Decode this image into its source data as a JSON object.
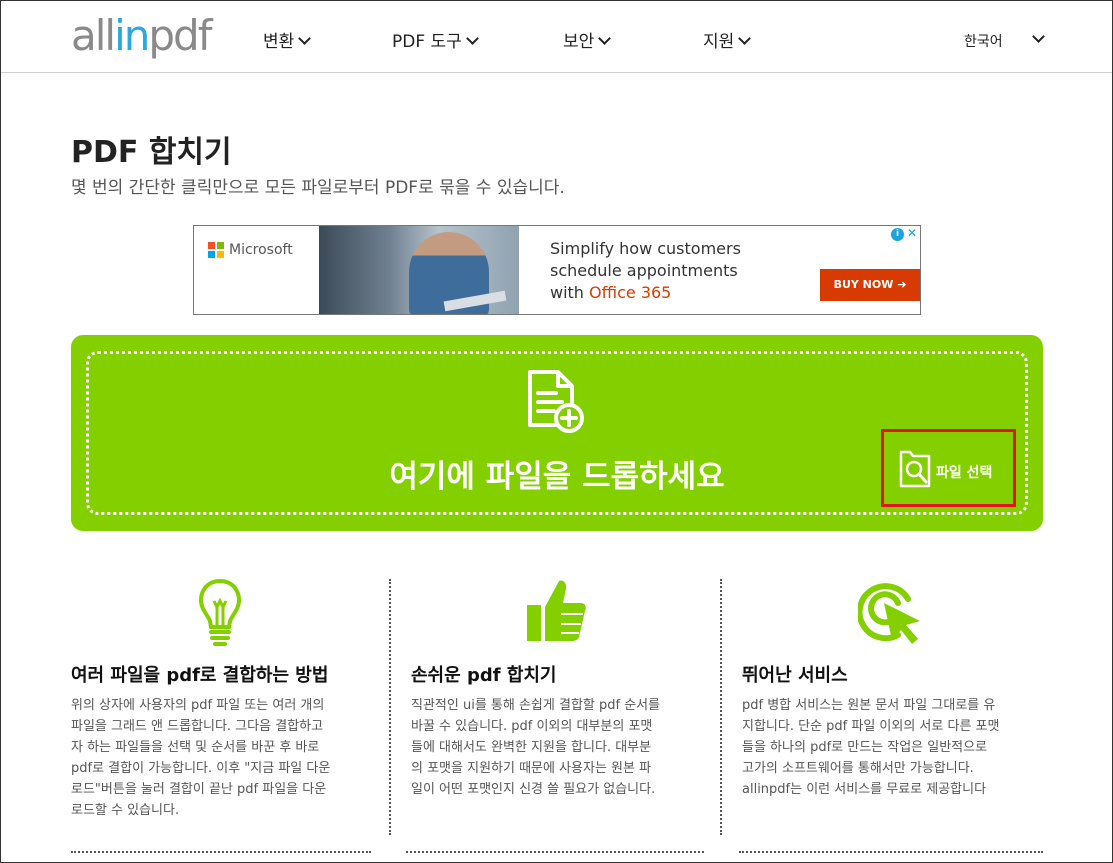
{
  "header": {
    "logo_prefix": "all",
    "logo_in": "in",
    "logo_suffix": "pdf",
    "nav": [
      "변환",
      "PDF 도구",
      "보안",
      "지원"
    ],
    "language": "한국어"
  },
  "page": {
    "title": "PDF 합치기",
    "subtitle": "몇 번의 간단한 클릭만으로 모든 파일로부터 PDF로 묶을 수 있습니다."
  },
  "ad": {
    "brand": "Microsoft",
    "line1": "Simplify how customers",
    "line2": "schedule appointments",
    "line3_prefix": "with ",
    "line3_highlight": "Office 365",
    "cta": "BUY NOW ➔",
    "info": "i",
    "close": "✕"
  },
  "dropzone": {
    "text": "여기에 파일을 드롭하세요",
    "file_select": "파일 선택"
  },
  "features": [
    {
      "icon": "lightbulb-icon",
      "title": "여러 파일을 pdf로 결합하는 방법",
      "lines": [
        "위의 상자에 사용자의 pdf 파일 또는 여러 개의",
        "파일을 그래드 앤 드롭합니다. 그다음 결합하고",
        "자 하는 파일들을 선택 및 순서를 바꾼 후 바로",
        "pdf로 결합이 가능합니다. 이후 \"지금 파일 다운",
        "로드\"버튼을 눌러 결합이 끝난 pdf 파일을 다운",
        "로드할 수 있습니다."
      ]
    },
    {
      "icon": "thumbs-up-icon",
      "title": "손쉬운 pdf 합치기",
      "lines": [
        "직관적인 ui를 통해 손쉽게 결합할 pdf 순서를",
        "바꿀 수 있습니다. pdf 이외의 대부분의 포맷",
        "들에 대해서도 완벽한 지원을 합니다. 대부분",
        "의 포맷을 지원하기 때문에 사용자는 원본 파",
        "일이 어떤 포맷인지 신경 쓸 필요가 없습니다."
      ]
    },
    {
      "icon": "target-cursor-icon",
      "title": "뛰어난 서비스",
      "lines": [
        "pdf 병합 서비스는 원본 문서 파일 그대로를 유",
        "지합니다. 단순 pdf 파일 이외의 서로 다른 포맷",
        "들을 하나의 pdf로 만드는 작업은 일반적으로",
        "고가의 소프트웨어를 통해서만 가능합니다.",
        "allinpdf는 이런 서비스를 무료로 제공합니다"
      ]
    }
  ],
  "colors": {
    "accent_green": "#84cf00",
    "logo_blue": "#2aa9e0",
    "highlight_red": "#e4141b",
    "office_orange": "#d83b01"
  }
}
